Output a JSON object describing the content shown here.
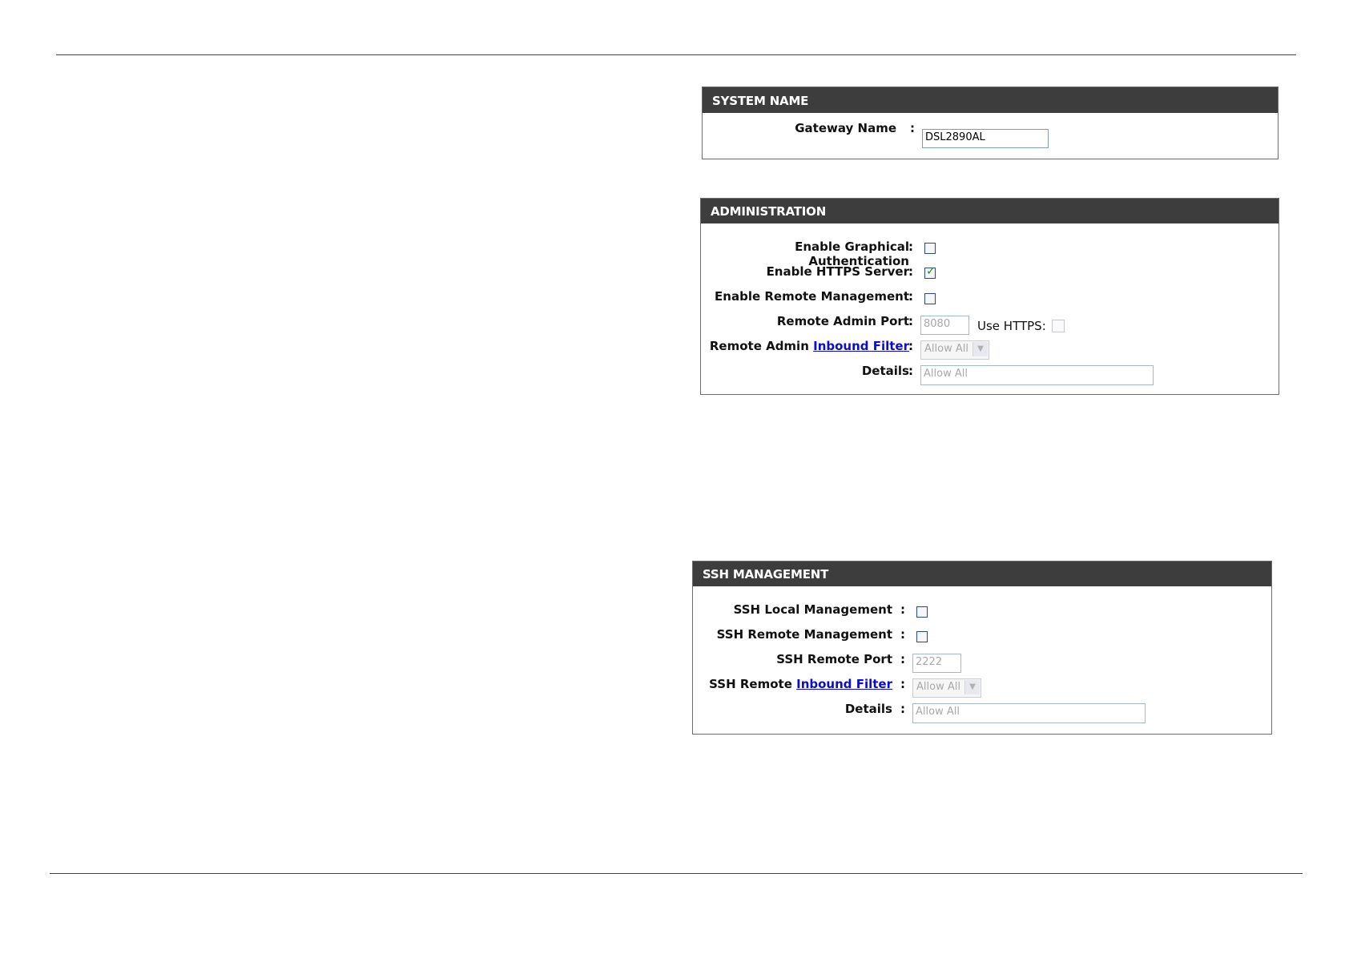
{
  "system_name": {
    "header": "SYSTEM NAME",
    "gateway_name_label": "Gateway Name",
    "gateway_name_value": "DSL2890AL"
  },
  "administration": {
    "header": "ADMINISTRATION",
    "graphical_auth_label_line1": "Enable Graphical",
    "graphical_auth_label_line2": "Authentication",
    "graphical_auth_checked": false,
    "https_server_label": "Enable HTTPS Server",
    "https_server_checked": true,
    "remote_mgmt_label": "Enable Remote Management",
    "remote_mgmt_checked": false,
    "remote_port_label": "Remote Admin Port",
    "remote_port_value": "8080",
    "use_https_label": "Use HTTPS:",
    "use_https_checked": false,
    "inbound_filter_label_prefix": "Remote Admin ",
    "inbound_filter_link": "Inbound Filter",
    "inbound_filter_selected": "Allow All",
    "details_label": "Details",
    "details_value": "Allow All"
  },
  "ssh_management": {
    "header": "SSH MANAGEMENT",
    "local_mgmt_label": "SSH Local Management",
    "local_mgmt_checked": false,
    "remote_mgmt_label": "SSH Remote Management",
    "remote_mgmt_checked": false,
    "remote_port_label": "SSH Remote Port",
    "remote_port_value": "2222",
    "inbound_filter_label_prefix": "SSH Remote ",
    "inbound_filter_link": "Inbound Filter",
    "inbound_filter_selected": "Allow All",
    "details_label": "Details",
    "details_value": "Allow All"
  },
  "colon": ":"
}
